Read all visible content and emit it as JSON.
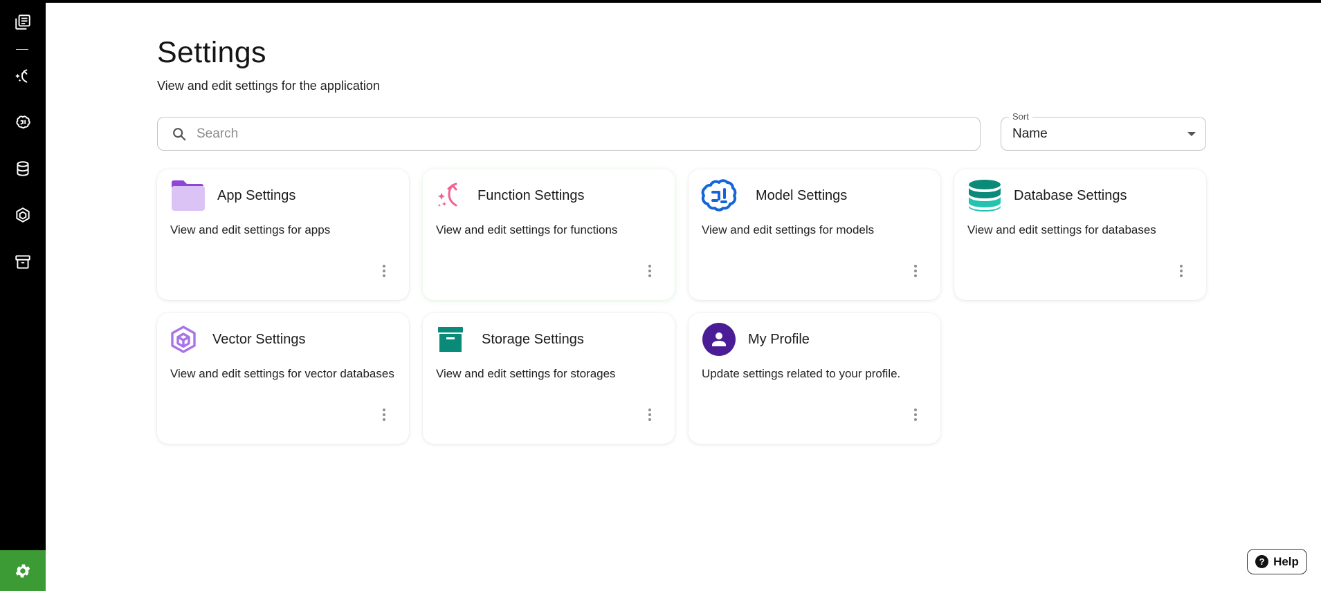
{
  "page": {
    "title": "Settings",
    "subtitle": "View and edit settings for the application"
  },
  "search": {
    "placeholder": "Search",
    "value": "",
    "icon": "search-icon"
  },
  "sort": {
    "label": "Sort",
    "value": "Name"
  },
  "sidebar": {
    "items": [
      {
        "icon": "library-icon"
      },
      {
        "icon": "function-icon"
      },
      {
        "icon": "brain-icon"
      },
      {
        "icon": "database-icon"
      },
      {
        "icon": "vector-icon"
      },
      {
        "icon": "storage-icon"
      }
    ],
    "active_item": {
      "icon": "gear-icon",
      "color": "#3c9b34"
    }
  },
  "cards": [
    {
      "title": "App Settings",
      "description": "View and edit settings for apps",
      "icon": "folder-icon",
      "color": "#b57ee6"
    },
    {
      "title": "Function Settings",
      "description": "View and edit settings for functions",
      "icon": "function-icon",
      "color": "#f06292"
    },
    {
      "title": "Model Settings",
      "description": "View and edit settings for models",
      "icon": "brain-icon",
      "color": "#1565d8"
    },
    {
      "title": "Database Settings",
      "description": "View and edit settings for databases",
      "icon": "database-icon",
      "color": "#15a89a"
    },
    {
      "title": "Vector Settings",
      "description": "View and edit settings for vector databases",
      "icon": "vector-icon",
      "color": "#a873e8"
    },
    {
      "title": "Storage Settings",
      "description": "View and edit settings for storages",
      "icon": "storage-icon",
      "color": "#0a8a78"
    },
    {
      "title": "My Profile",
      "description": "Update settings related to your profile.",
      "icon": "profile-icon",
      "color": "#4a1d96"
    }
  ],
  "help": {
    "label": "Help",
    "icon": "help-icon"
  }
}
